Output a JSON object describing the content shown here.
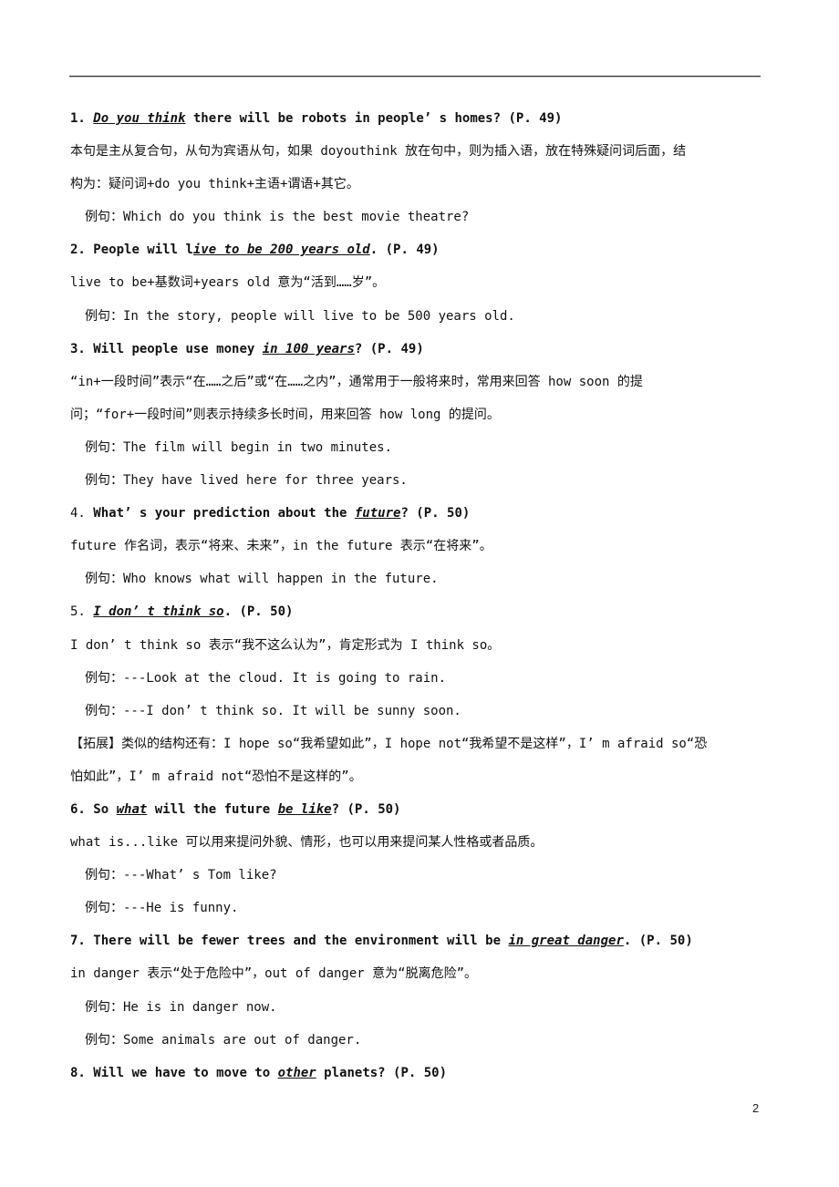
{
  "page_number": "2",
  "items": [
    {
      "heading": {
        "num": "1. ",
        "pre": "",
        "key": "Do you think",
        "mid": " there will be robots in people’ s homes? (P. 49)",
        "key2": "",
        "post": ""
      },
      "explanation": [
        "本句是主从复合句，从句为宾语从句，如果 doyouthink 放在句中，则为插入语，放在特殊疑问词后面，结",
        "构为：疑问词+do you think+主语+谓语+其它。"
      ],
      "examples": [
        "例句：Which do you think is the best movie theatre?"
      ]
    },
    {
      "heading": {
        "num": "2. ",
        "pre": "People will l",
        "key": "ive to be 200 years old",
        "mid": ". (P. 49)",
        "key2": "",
        "post": ""
      },
      "explanation": [
        "live to be+基数词+years old 意为“活到……岁”。"
      ],
      "examples": [
        "例句：In the story, people will live to be 500 years old."
      ]
    },
    {
      "heading": {
        "num": "3. ",
        "pre": "Will people use money ",
        "key": "in 100 years",
        "mid": "? (P. 49)",
        "key2": "",
        "post": ""
      },
      "explanation": [
        "“in+一段时间”表示“在……之后”或“在……之内”，通常用于一般将来时，常用来回答 how soon 的提",
        "问；“for+一段时间”则表示持续多长时间，用来回答 how long 的提问。"
      ],
      "examples": [
        "例句：The film will begin in two minutes.",
        "例句：They have lived here for three years."
      ]
    },
    {
      "heading": {
        "num": "4. ",
        "pre": "What’ s your prediction about the ",
        "key": "future",
        "mid": "? (P. 50)",
        "key2": "",
        "post": ""
      },
      "explanation": [
        "future 作名词，表示“将来、未来”，in the future 表示“在将来”。"
      ],
      "examples": [
        "例句：Who knows what will happen in the future."
      ]
    },
    {
      "heading": {
        "num": "5. ",
        "pre": "",
        "key": "I don’ t think so",
        "mid": ". (P. 50)",
        "key2": "",
        "post": ""
      },
      "explanation": [
        "I don’ t think so 表示“我不这么认为”，肯定形式为 I think so。"
      ],
      "examples": [
        "例句：---Look at the cloud. It is going to rain.",
        "例句：---I don’ t think so. It will be sunny soon."
      ],
      "extension": [
        "【拓展】类似的结构还有：I hope so“我希望如此”，I hope not“我希望不是这样”，I’ m afraid so“恐",
        "怕如此”，I’ m afraid not“恐怕不是这样的”。"
      ]
    },
    {
      "heading": {
        "num": "6. ",
        "pre": "So ",
        "key": "what",
        "mid": " will the future ",
        "key2": "be like",
        "post": "? (P. 50)"
      },
      "explanation": [
        "what is...like 可以用来提问外貌、情形，也可以用来提问某人性格或者品质。"
      ],
      "examples": [
        "例句：---What’ s Tom like?",
        "例句：---He is funny."
      ]
    },
    {
      "heading": {
        "num": "7. ",
        "pre": "There will be fewer trees and the environment will be ",
        "key": "in great danger",
        "mid": ". (P. 50)",
        "key2": "",
        "post": ""
      },
      "explanation": [
        "in danger 表示“处于危险中”，out of danger 意为“脱离危险”。"
      ],
      "examples": [
        "例句：He is in danger now.",
        "例句：Some animals are out of danger."
      ]
    },
    {
      "heading": {
        "num": "8. ",
        "pre": "Will we have to move to ",
        "key": "other",
        "mid": " planets? (P. 50)",
        "key2": "",
        "post": ""
      },
      "explanation": [],
      "examples": []
    }
  ]
}
